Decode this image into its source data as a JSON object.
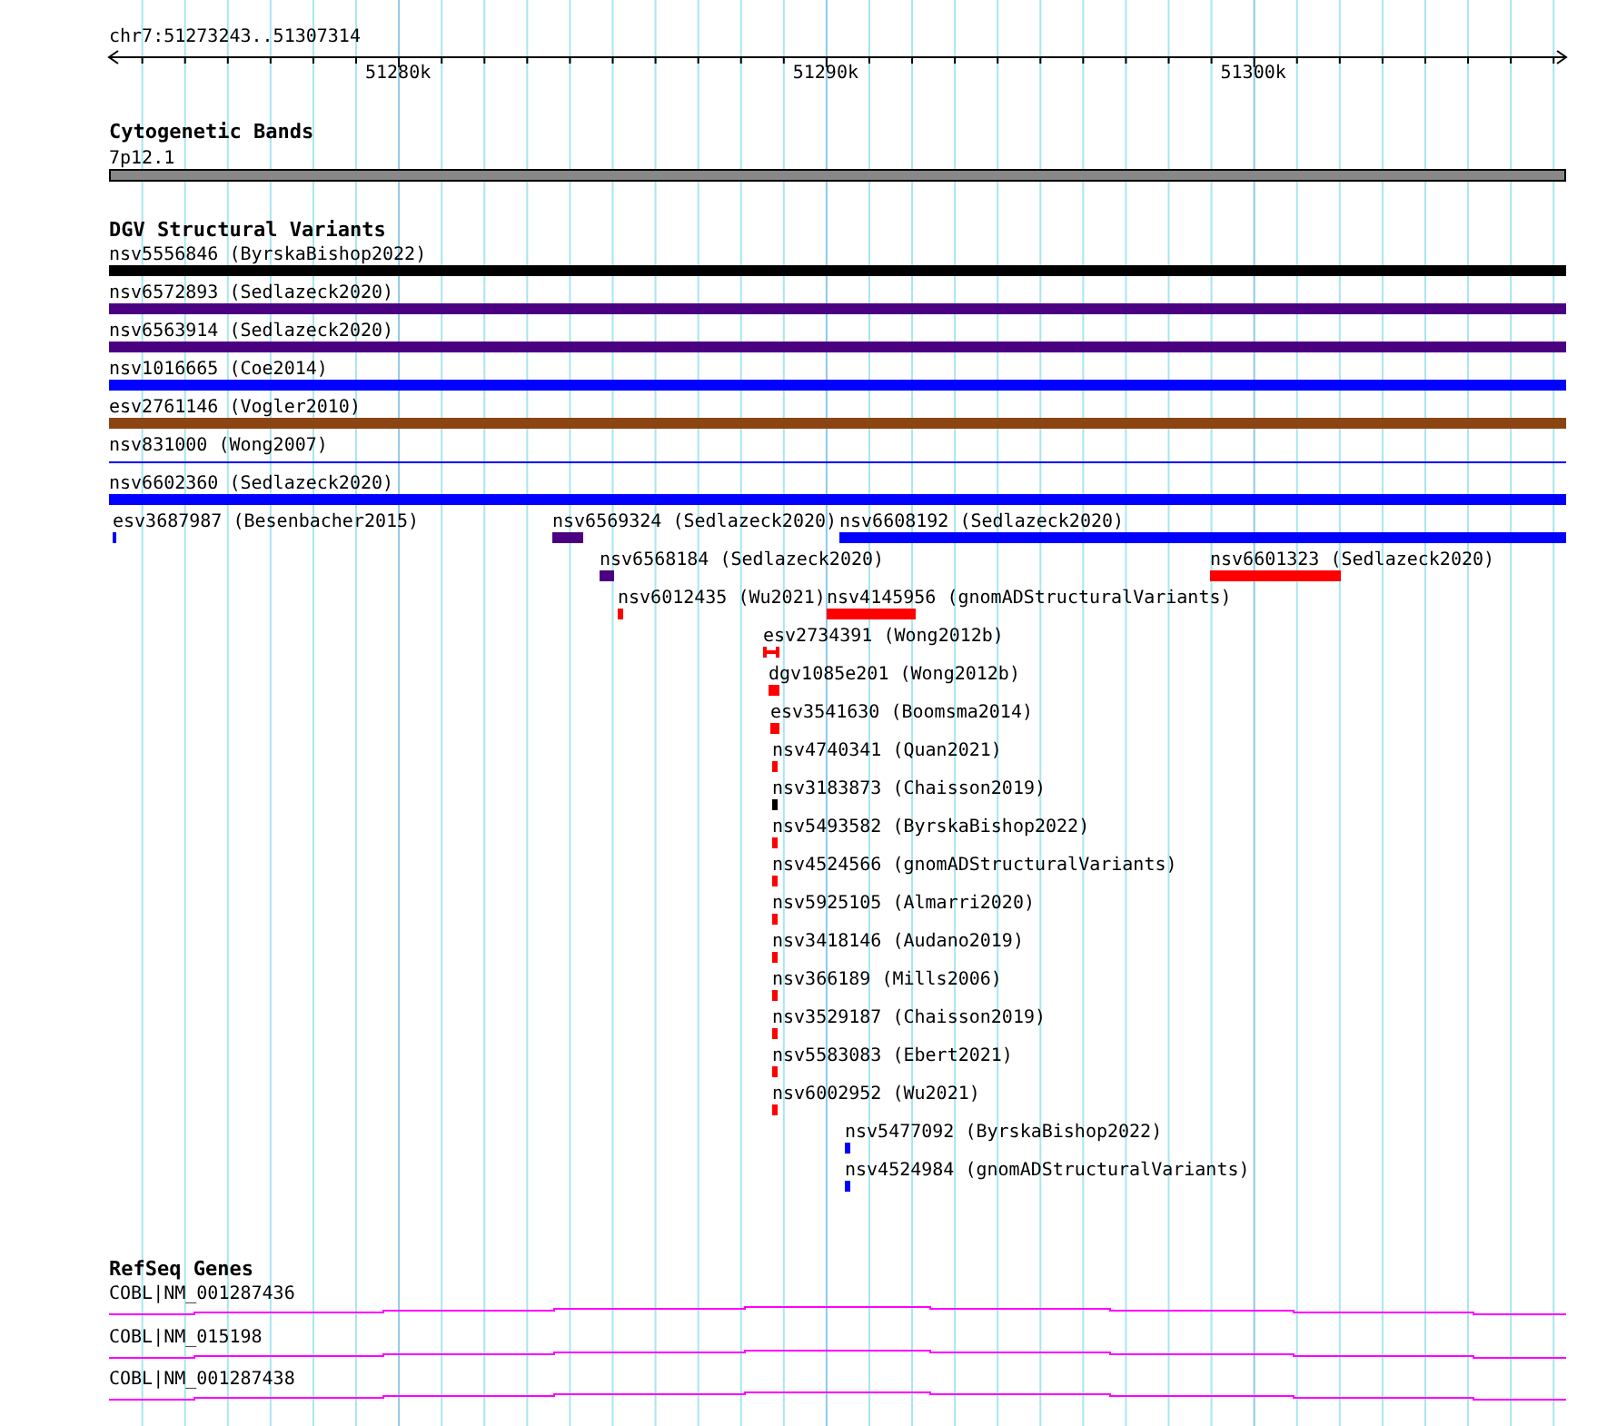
{
  "ruler": {
    "range": "chr7:51273243..51307314",
    "ticks": [
      "51280k",
      "51290k",
      "51300k"
    ]
  },
  "tracks": [
    {
      "title": "Cytogenetic Bands",
      "kind": "cytoband",
      "features": [
        {
          "label": "7p12.1"
        }
      ]
    },
    {
      "title": "DGV Structural Variants",
      "kind": "variants",
      "features": [
        {
          "label": "nsv5556846 (ByrskaBishop2022)",
          "kind": "bar",
          "color": "#000000"
        },
        {
          "label": "nsv6572893 (Sedlazeck2020)",
          "kind": "bar",
          "color": "#4b0082"
        },
        {
          "label": "nsv6563914 (Sedlazeck2020)",
          "kind": "bar",
          "color": "#4b0082"
        },
        {
          "label": "nsv1016665 (Coe2014)",
          "kind": "bar",
          "color": "#0000ff"
        },
        {
          "label": "esv2761146 (Vogler2010)",
          "kind": "bar",
          "color": "#8b4513"
        },
        {
          "label": "nsv831000 (Wong2007)",
          "kind": "line",
          "color": "#0000ff"
        },
        {
          "label": "nsv6602360 (Sedlazeck2020)",
          "kind": "bar",
          "color": "#0000ff"
        },
        {
          "label": "esv3687987 (Besenbacher2015)",
          "kind": "bar",
          "color": "#0000ff"
        },
        {
          "label": "nsv6569324 (Sedlazeck2020)",
          "kind": "bar",
          "color": "#4b0082"
        },
        {
          "label": "nsv6608192 (Sedlazeck2020)",
          "kind": "bar",
          "color": "#0000ff"
        },
        {
          "label": "nsv6568184 (Sedlazeck2020)",
          "kind": "bar",
          "color": "#4b0082"
        },
        {
          "label": "nsv6601323 (Sedlazeck2020)",
          "kind": "bar",
          "color": "#ff0000"
        },
        {
          "label": "nsv6012435 (Wu2021)",
          "kind": "bar",
          "color": "#ff0000"
        },
        {
          "label": "nsv4145956 (gnomADStructuralVariants)",
          "kind": "bar",
          "color": "#ff0000"
        },
        {
          "label": "esv2734391 (Wong2012b)",
          "kind": "bracket",
          "color": "#ff0000"
        },
        {
          "label": "dgv1085e201 (Wong2012b)",
          "kind": "bar",
          "color": "#ff0000"
        },
        {
          "label": "esv3541630 (Boomsma2014)",
          "kind": "bar",
          "color": "#ff0000"
        },
        {
          "label": "nsv4740341 (Quan2021)",
          "kind": "bar",
          "color": "#ff0000"
        },
        {
          "label": "nsv3183873 (Chaisson2019)",
          "kind": "bar",
          "color": "#000000"
        },
        {
          "label": "nsv5493582 (ByrskaBishop2022)",
          "kind": "bar",
          "color": "#ff0000"
        },
        {
          "label": "nsv4524566 (gnomADStructuralVariants)",
          "kind": "bar",
          "color": "#ff0000"
        },
        {
          "label": "nsv5925105 (Almarri2020)",
          "kind": "bar",
          "color": "#ff0000"
        },
        {
          "label": "nsv3418146 (Audano2019)",
          "kind": "bar",
          "color": "#ff0000"
        },
        {
          "label": "nsv366189 (Mills2006)",
          "kind": "bar",
          "color": "#ff0000"
        },
        {
          "label": "nsv3529187 (Chaisson2019)",
          "kind": "bar",
          "color": "#ff0000"
        },
        {
          "label": "nsv5583083 (Ebert2021)",
          "kind": "bar",
          "color": "#ff0000"
        },
        {
          "label": "nsv6002952 (Wu2021)",
          "kind": "bar",
          "color": "#ff0000"
        },
        {
          "label": "nsv5477092 (ByrskaBishop2022)",
          "kind": "bar",
          "color": "#0000ff"
        },
        {
          "label": "nsv4524984 (gnomADStructuralVariants)",
          "kind": "bar",
          "color": "#0000ff"
        }
      ]
    },
    {
      "title": "RefSeq Genes",
      "kind": "genes",
      "features": [
        {
          "label": "COBL|NM_001287436"
        },
        {
          "label": "COBL|NM_015198"
        },
        {
          "label": "COBL|NM_001287438"
        }
      ]
    }
  ]
}
